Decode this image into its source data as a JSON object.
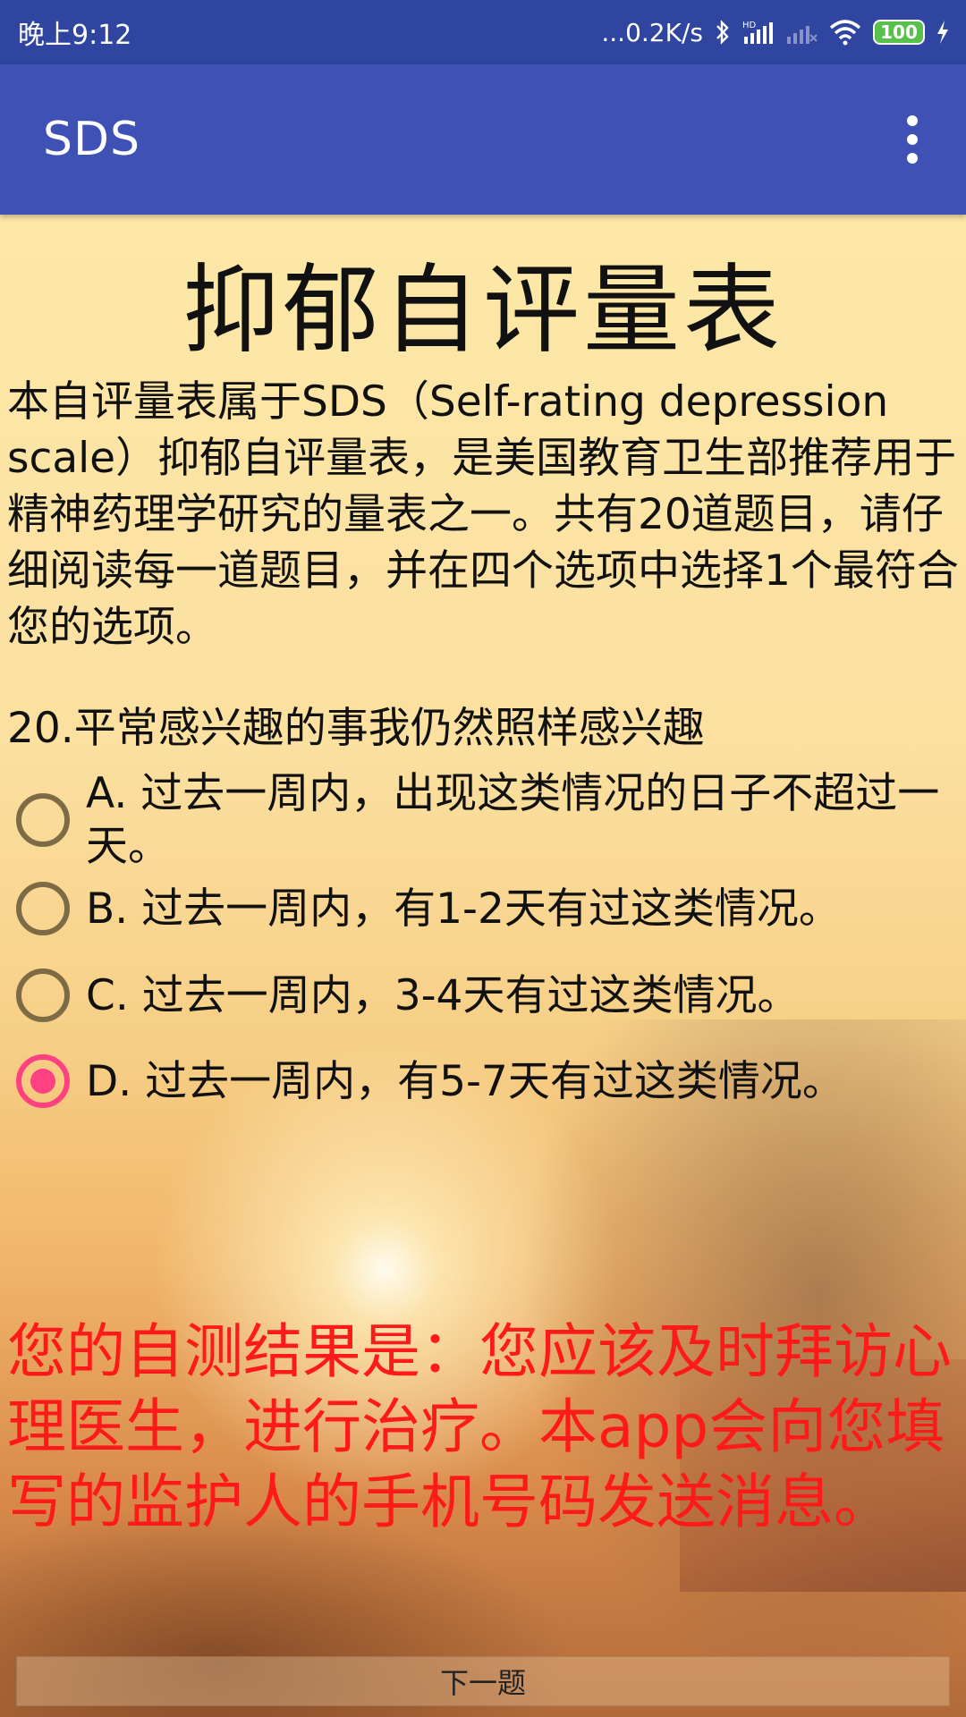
{
  "status_bar": {
    "time": "晚上9:12",
    "net_speed": "...0.2K/s",
    "battery": "100",
    "icons": [
      "bluetooth-icon",
      "hd-signal-icon",
      "signal-icon",
      "wifi-icon",
      "battery-icon",
      "charging-icon"
    ]
  },
  "app_bar": {
    "title": "SDS",
    "menu_icon": "overflow-menu-icon"
  },
  "content": {
    "title": "抑郁自评量表",
    "intro": "本自评量表属于SDS（Self-rating depression scale）抑郁自评量表，是美国教育卫生部推荐用于精神药理学研究的量表之一。共有20道题目，请仔细阅读每一道题目，并在四个选项中选择1个最符合您的选项。",
    "question": "20.平常感兴趣的事我仍然照样感兴趣",
    "options": [
      {
        "label": "A. 过去一周内，出现这类情况的日子不超过一天。",
        "checked": false
      },
      {
        "label": "B. 过去一周内，有1-2天有过这类情况。",
        "checked": false
      },
      {
        "label": "C. 过去一周内，3-4天有过这类情况。",
        "checked": false
      },
      {
        "label": "D. 过去一周内，有5-7天有过这类情况。",
        "checked": true
      }
    ],
    "result": "您的自测结果是：您应该及时拜访心理医生，进行治疗。本app会向您填写的监护人的手机号码发送消息。",
    "next_button": "下一题"
  },
  "colors": {
    "status_bar": "#2f45a0",
    "app_bar": "#3f51b5",
    "accent": "#ff4081",
    "result_text": "#ff1a1a"
  }
}
